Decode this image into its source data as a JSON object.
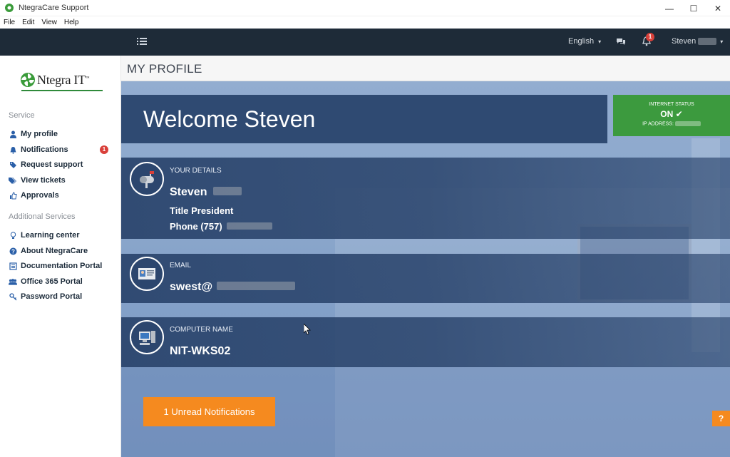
{
  "window": {
    "title": "NtegraCare Support",
    "controls": {
      "minimize": "—",
      "maximize": "☐",
      "close": "✕"
    }
  },
  "menubar": {
    "items": [
      "File",
      "Edit",
      "View",
      "Help"
    ]
  },
  "topbar": {
    "language": "English",
    "notification_count": "1",
    "user_name": "Steven"
  },
  "sidebar": {
    "logo_text": "Ntegra IT",
    "logo_tm": "™",
    "section_service": "Service",
    "service_items": [
      {
        "label": "My profile",
        "icon": "user-icon"
      },
      {
        "label": "Notifications",
        "icon": "bell-icon",
        "badge": "1"
      },
      {
        "label": "Request support",
        "icon": "tag-icon"
      },
      {
        "label": "View tickets",
        "icon": "tags-icon"
      },
      {
        "label": "Approvals",
        "icon": "thumbs-up-icon"
      }
    ],
    "section_additional": "Additional Services",
    "additional_items": [
      {
        "label": "Learning center",
        "icon": "lightbulb-icon"
      },
      {
        "label": "About NtegraCare",
        "icon": "question-circle-icon"
      },
      {
        "label": "Documentation Portal",
        "icon": "document-icon"
      },
      {
        "label": "Office 365 Portal",
        "icon": "users-icon"
      },
      {
        "label": "Password Portal",
        "icon": "key-icon"
      }
    ]
  },
  "page": {
    "title": "MY PROFILE",
    "welcome": "Welcome Steven",
    "internet_status": {
      "label": "INTERNET STATUS",
      "value": "ON",
      "ip_label": "IP ADDRESS:"
    },
    "details": {
      "label": "YOUR DETAILS",
      "name": "Steven",
      "title": "Title President",
      "phone": "Phone (757)"
    },
    "email": {
      "label": "EMAIL",
      "value": "swest@"
    },
    "computer": {
      "label": "COMPUTER NAME",
      "value": "NIT-WKS02"
    },
    "unread_button": "1 Unread Notifications",
    "help_button": "?"
  },
  "colors": {
    "topbar": "#1e2b38",
    "card": "#2f4a72",
    "status_green": "#3c9a3e",
    "accent_orange": "#f58a1f",
    "badge_red": "#d9403a"
  }
}
